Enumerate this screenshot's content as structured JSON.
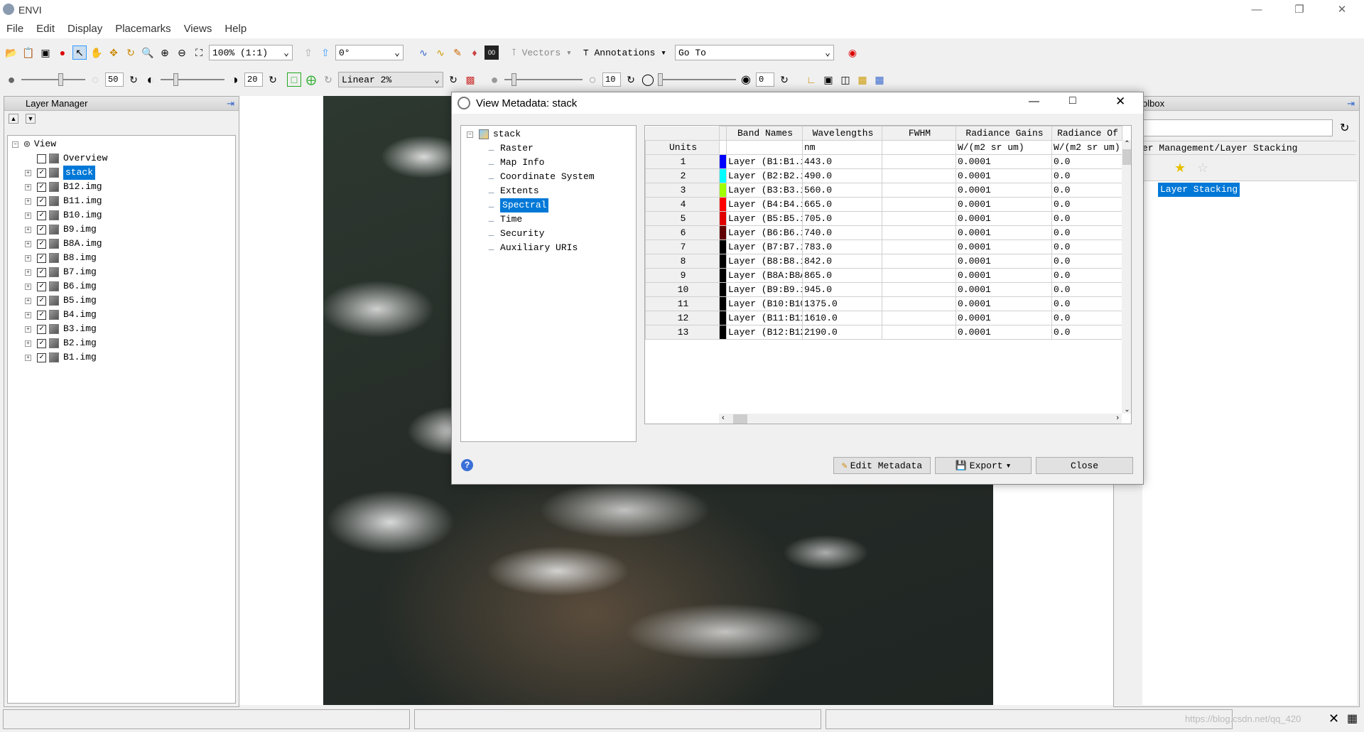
{
  "app": {
    "title": "ENVI"
  },
  "menu": [
    "File",
    "Edit",
    "Display",
    "Placemarks",
    "Views",
    "Help"
  ],
  "toolbar": {
    "zoom": "100% (1:1)",
    "rotation": "0°",
    "vectors": "Vectors",
    "annotations": "Annotations",
    "goto": "Go To",
    "brightness": "50",
    "contrast": "20",
    "stretch": "Linear 2%",
    "sharpen": "10",
    "transparency": "0"
  },
  "layer_manager": {
    "title": "Layer Manager",
    "root": "View",
    "items": [
      {
        "label": "Overview",
        "checked": false
      },
      {
        "label": "stack",
        "checked": true,
        "selected": true
      },
      {
        "label": "B12.img",
        "checked": true
      },
      {
        "label": "B11.img",
        "checked": true
      },
      {
        "label": "B10.img",
        "checked": true
      },
      {
        "label": "B9.img",
        "checked": true
      },
      {
        "label": "B8A.img",
        "checked": true
      },
      {
        "label": "B8.img",
        "checked": true
      },
      {
        "label": "B7.img",
        "checked": true
      },
      {
        "label": "B6.img",
        "checked": true
      },
      {
        "label": "B5.img",
        "checked": true
      },
      {
        "label": "B4.img",
        "checked": true
      },
      {
        "label": "B3.img",
        "checked": true
      },
      {
        "label": "B2.img",
        "checked": true
      },
      {
        "label": "B1.img",
        "checked": true
      }
    ]
  },
  "toolbox": {
    "title": "olbox",
    "path": "er Management/Layer Stacking",
    "item": "Layer Stacking"
  },
  "dialog": {
    "title": "View Metadata: stack",
    "tree_root": "stack",
    "tree_items": [
      "Raster",
      "Map Info",
      "Coordinate System",
      "Extents",
      "Spectral",
      "Time",
      "Security",
      "Auxiliary URIs"
    ],
    "selected": "Spectral",
    "columns": [
      "Band Names",
      "Wavelengths",
      "FWHM",
      "Radiance Gains",
      "Radiance Of"
    ],
    "units_label": "Units",
    "units": [
      "",
      "nm",
      "",
      "W/(m2 sr um)",
      "W/(m2 sr um)"
    ],
    "rows": [
      {
        "n": "1",
        "color": "#0000ff",
        "name": "Layer (B1:B1.i",
        "wl": "443.0",
        "gain": "0.0001",
        "off": "0.0"
      },
      {
        "n": "2",
        "color": "#00ffff",
        "name": "Layer (B2:B2.i",
        "wl": "490.0",
        "gain": "0.0001",
        "off": "0.0"
      },
      {
        "n": "3",
        "color": "#a0ff00",
        "name": "Layer (B3:B3.i",
        "wl": "560.0",
        "gain": "0.0001",
        "off": "0.0"
      },
      {
        "n": "4",
        "color": "#ff0000",
        "name": "Layer (B4:B4.i",
        "wl": "665.0",
        "gain": "0.0001",
        "off": "0.0"
      },
      {
        "n": "5",
        "color": "#e00000",
        "name": "Layer (B5:B5.i",
        "wl": "705.0",
        "gain": "0.0001",
        "off": "0.0"
      },
      {
        "n": "6",
        "color": "#600000",
        "name": "Layer (B6:B6.i",
        "wl": "740.0",
        "gain": "0.0001",
        "off": "0.0"
      },
      {
        "n": "7",
        "color": "#000000",
        "name": "Layer (B7:B7.i",
        "wl": "783.0",
        "gain": "0.0001",
        "off": "0.0"
      },
      {
        "n": "8",
        "color": "#000000",
        "name": "Layer (B8:B8.i",
        "wl": "842.0",
        "gain": "0.0001",
        "off": "0.0"
      },
      {
        "n": "9",
        "color": "#000000",
        "name": "Layer (B8A:B8A",
        "wl": "865.0",
        "gain": "0.0001",
        "off": "0.0"
      },
      {
        "n": "10",
        "color": "#000000",
        "name": "Layer (B9:B9.i",
        "wl": "945.0",
        "gain": "0.0001",
        "off": "0.0"
      },
      {
        "n": "11",
        "color": "#000000",
        "name": "Layer (B10:B10",
        "wl": "1375.0",
        "gain": "0.0001",
        "off": "0.0"
      },
      {
        "n": "12",
        "color": "#000000",
        "name": "Layer (B11:B11",
        "wl": "1610.0",
        "gain": "0.0001",
        "off": "0.0"
      },
      {
        "n": "13",
        "color": "#000000",
        "name": "Layer (B12:B12",
        "wl": "2190.0",
        "gain": "0.0001",
        "off": "0.0"
      }
    ],
    "buttons": {
      "edit": "Edit Metadata",
      "export": "Export",
      "close": "Close"
    }
  },
  "watermark": "https://blog.csdn.net/qq_420"
}
